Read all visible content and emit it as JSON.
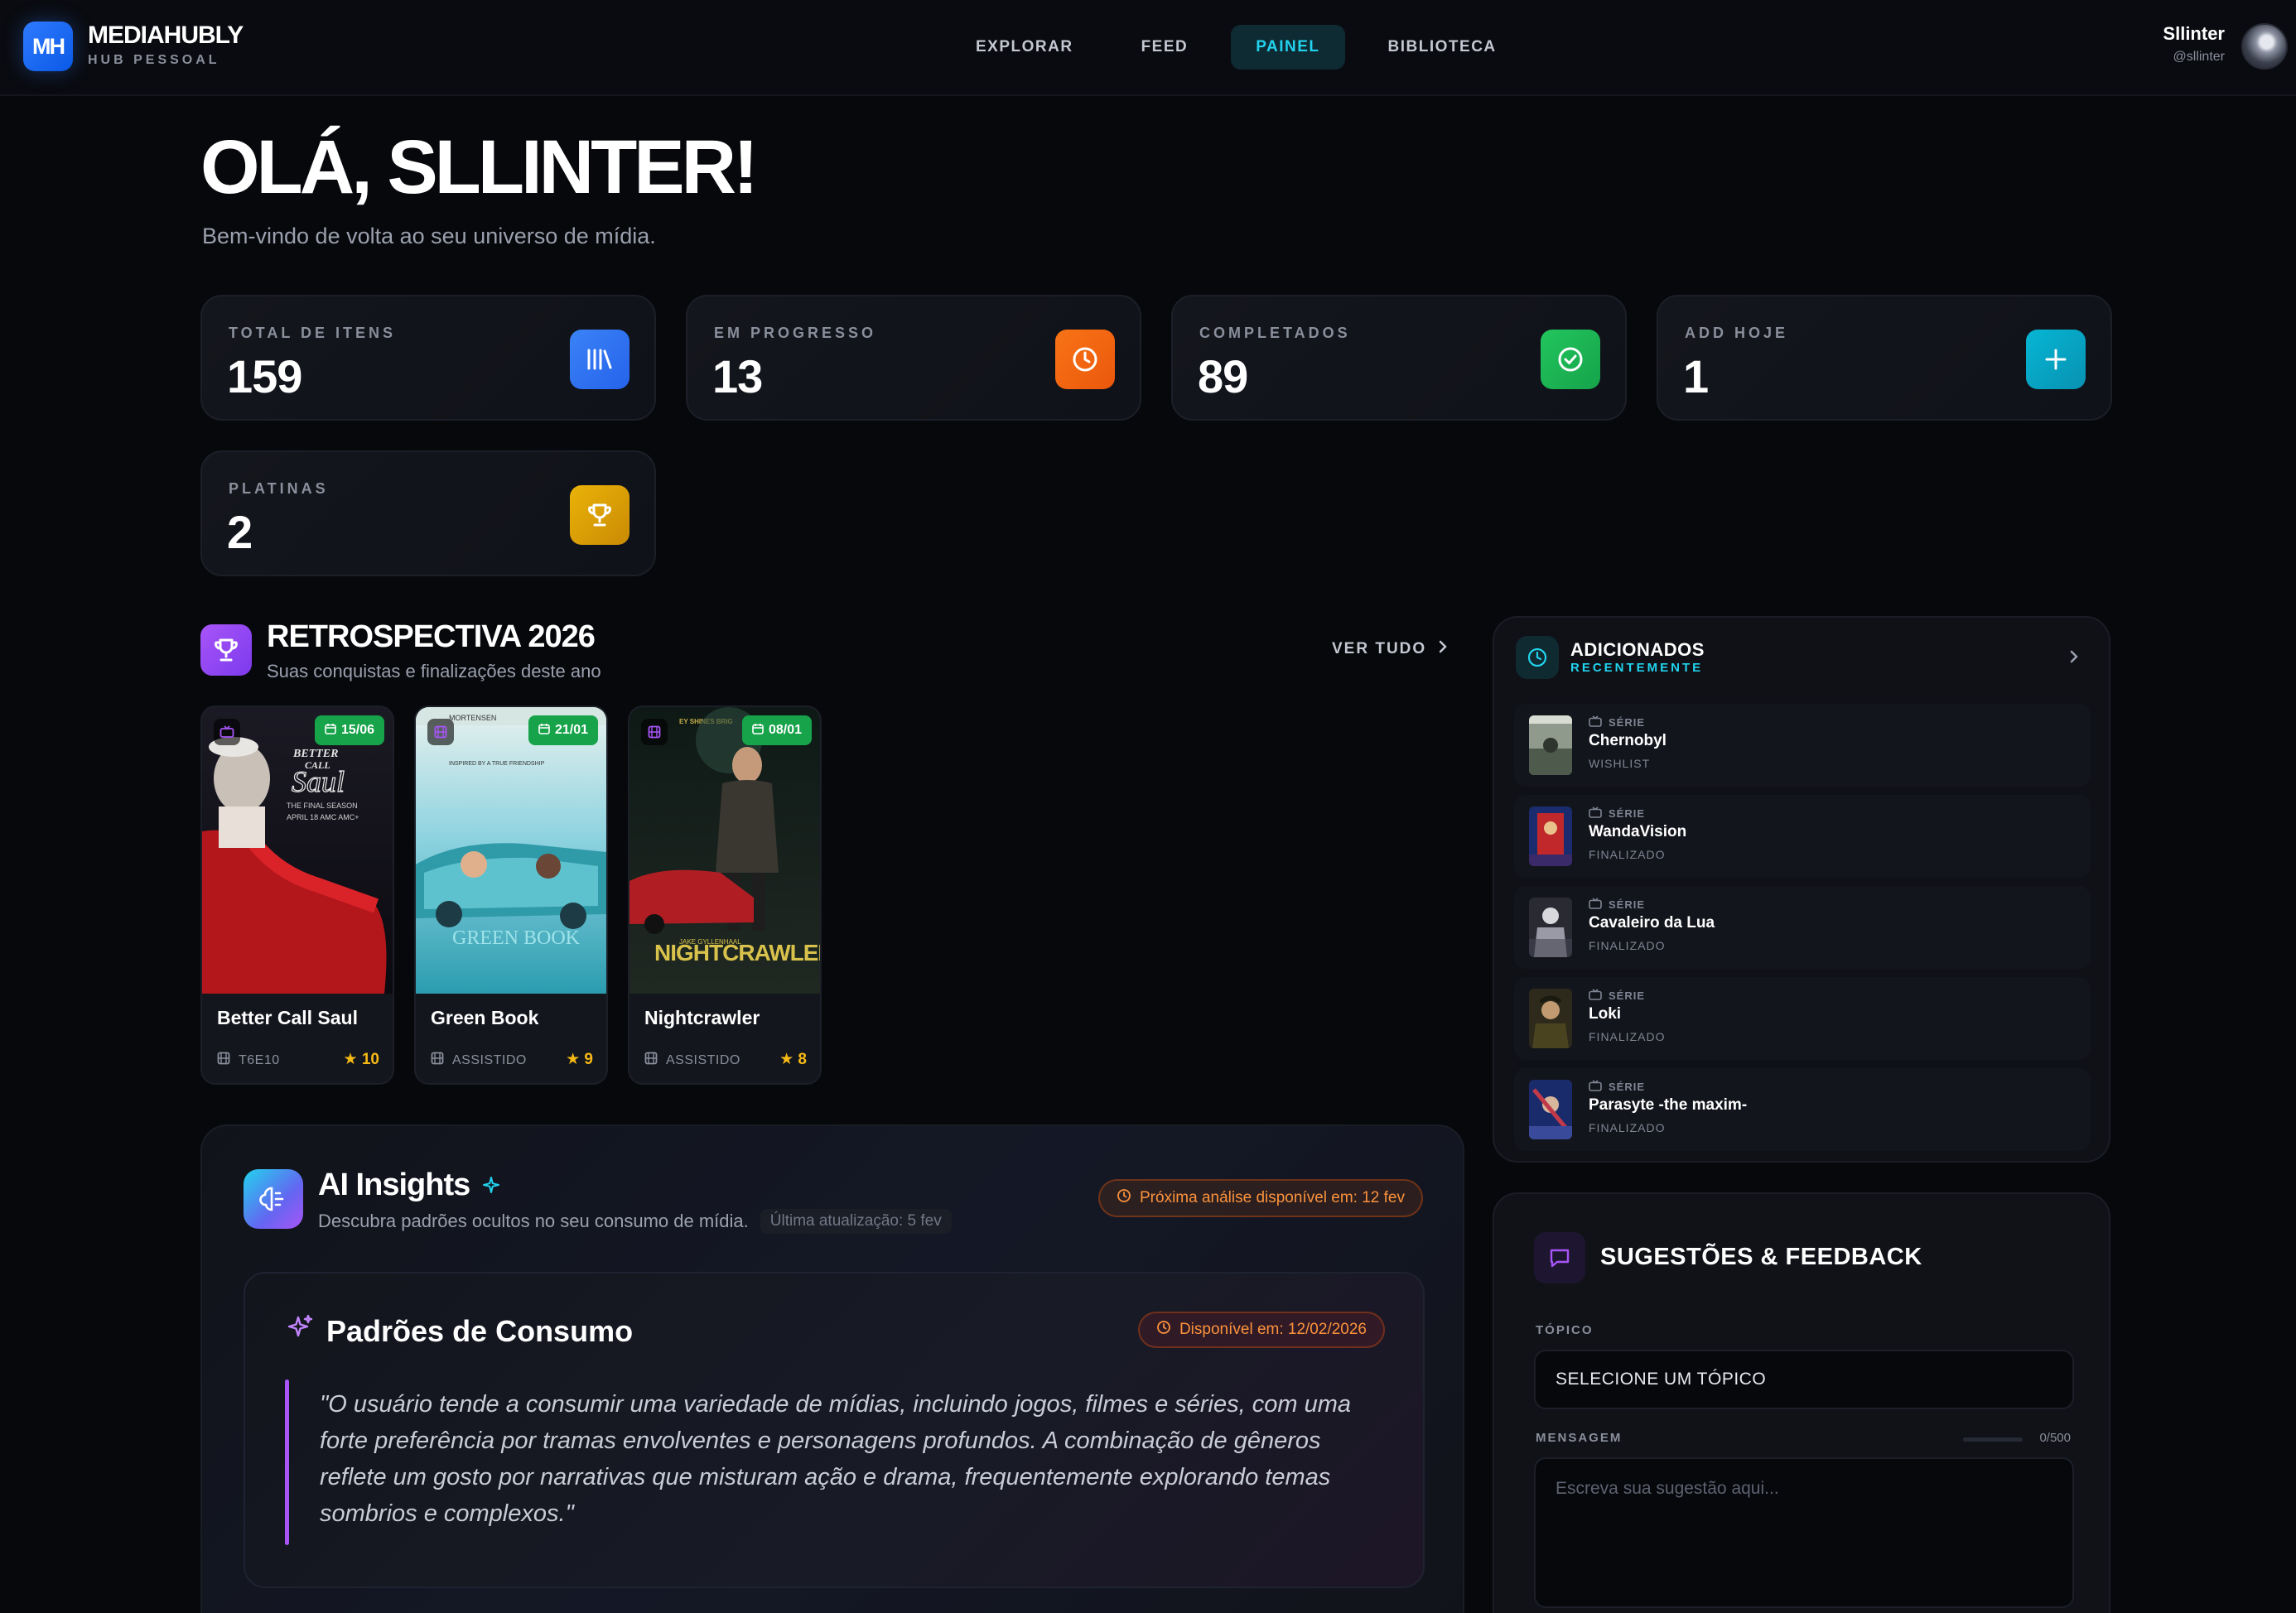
{
  "app": {
    "logo_badge": "MH",
    "name": "MEDIAHUBLY",
    "subtitle": "HUB PESSOAL"
  },
  "nav": {
    "items": [
      "EXPLORAR",
      "FEED",
      "PAINEL",
      "BIBLIOTECA"
    ],
    "active": "PAINEL"
  },
  "user": {
    "name": "Sllinter",
    "handle": "@sllinter"
  },
  "greeting": {
    "title": "OLÁ, SLLINTER!",
    "subtitle": "Bem-vindo de volta ao seu universo de mídia."
  },
  "stats": [
    {
      "label": "TOTAL DE ITENS",
      "value": "159",
      "icon": "library-icon",
      "color": "#3b82f6"
    },
    {
      "label": "EM PROGRESSO",
      "value": "13",
      "icon": "clock-icon",
      "color": "#f97316"
    },
    {
      "label": "COMPLETADOS",
      "value": "89",
      "icon": "check-circle-icon",
      "color": "#16a34a"
    },
    {
      "label": "ADD HOJE",
      "value": "1",
      "icon": "plus-icon",
      "color": "#06b6d4"
    },
    {
      "label": "PLATINAS",
      "value": "2",
      "icon": "trophy-icon",
      "color": "#eab308"
    }
  ],
  "retro": {
    "title": "RETROSPECTIVA 2026",
    "subtitle": "Suas conquistas e finalizações deste ano",
    "see_all": "VER TUDO",
    "cards": [
      {
        "title": "Better Call Saul",
        "date": "15/06",
        "meta": "T6E10",
        "rating": "10",
        "type_icon": "tv-icon"
      },
      {
        "title": "Green Book",
        "date": "21/01",
        "meta": "ASSISTIDO",
        "rating": "9",
        "type_icon": "film-icon"
      },
      {
        "title": "Nightcrawler",
        "date": "08/01",
        "meta": "ASSISTIDO",
        "rating": "8",
        "type_icon": "film-icon"
      }
    ]
  },
  "recent": {
    "title": "ADICIONADOS",
    "subtitle": "RECENTEMENTE",
    "items": [
      {
        "kind": "SÉRIE",
        "name": "Chernobyl",
        "status": "WISHLIST"
      },
      {
        "kind": "SÉRIE",
        "name": "WandaVision",
        "status": "FINALIZADO"
      },
      {
        "kind": "SÉRIE",
        "name": "Cavaleiro da Lua",
        "status": "FINALIZADO"
      },
      {
        "kind": "SÉRIE",
        "name": "Loki",
        "status": "FINALIZADO"
      },
      {
        "kind": "SÉRIE",
        "name": "Parasyte -the maxim-",
        "status": "FINALIZADO"
      }
    ]
  },
  "ai": {
    "title": "AI Insights",
    "subtitle": "Descubra padrões ocultos no seu consumo de mídia.",
    "updated": "Última atualização: 5 fev",
    "next": "Próxima análise disponível em: 12 fev",
    "pattern_title": "Padrões de Consumo",
    "pattern_available": "Disponível em: 12/02/2026",
    "pattern_quote": "\"O usuário tende a consumir uma variedade de mídias, incluindo jogos, filmes e séries, com uma forte preferência por tramas envolventes e personagens profundos. A combinação de gêneros reflete um gosto por narrativas que misturam ação e drama, frequentemente explorando temas sombrios e complexos.\""
  },
  "feedback": {
    "title": "SUGESTÕES & FEEDBACK",
    "topic_label": "TÓPICO",
    "topic_value": "SELECIONE UM TÓPICO",
    "message_label": "MENSAGEM",
    "counter": "0/500",
    "placeholder": "Escreva sua sugestão aqui..."
  }
}
